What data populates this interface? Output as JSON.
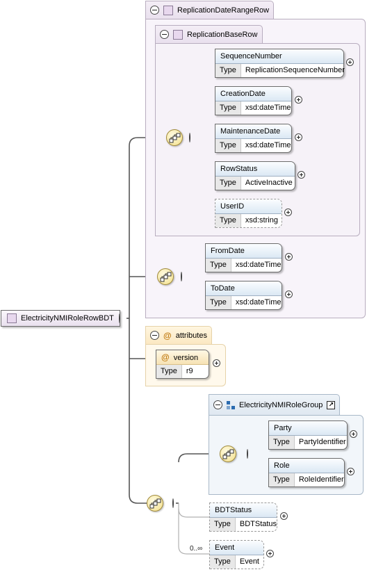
{
  "root": {
    "label": "ElectricityNMIRoleRowBDT"
  },
  "groups": {
    "replication_date_range_row": {
      "label": "ReplicationDateRangeRow"
    },
    "replication_base_row": {
      "label": "ReplicationBaseRow"
    },
    "attributes": {
      "label": "attributes"
    },
    "electricity_nmi_role_group": {
      "label": "ElectricityNMIRoleGroup"
    }
  },
  "type_key": "Type",
  "attribute_symbol": "@",
  "elements": {
    "sequence_number": {
      "name": "SequenceNumber",
      "type": "ReplicationSequenceNumber"
    },
    "creation_date": {
      "name": "CreationDate",
      "type": "xsd:dateTime"
    },
    "maintenance_date": {
      "name": "MaintenanceDate",
      "type": "xsd:dateTime"
    },
    "row_status": {
      "name": "RowStatus",
      "type": "ActiveInactive"
    },
    "user_id": {
      "name": "UserID",
      "type": "xsd:string"
    },
    "from_date": {
      "name": "FromDate",
      "type": "xsd:dateTime"
    },
    "to_date": {
      "name": "ToDate",
      "type": "xsd:dateTime"
    },
    "version": {
      "name": "version",
      "type": "r9"
    },
    "party": {
      "name": "Party",
      "type": "PartyIdentifier"
    },
    "role": {
      "name": "Role",
      "type": "RoleIdentifier"
    },
    "bdt_status": {
      "name": "BDTStatus",
      "type": "BDTStatus"
    },
    "event": {
      "name": "Event",
      "type": "Event",
      "occurrence": "0..∞"
    }
  }
}
